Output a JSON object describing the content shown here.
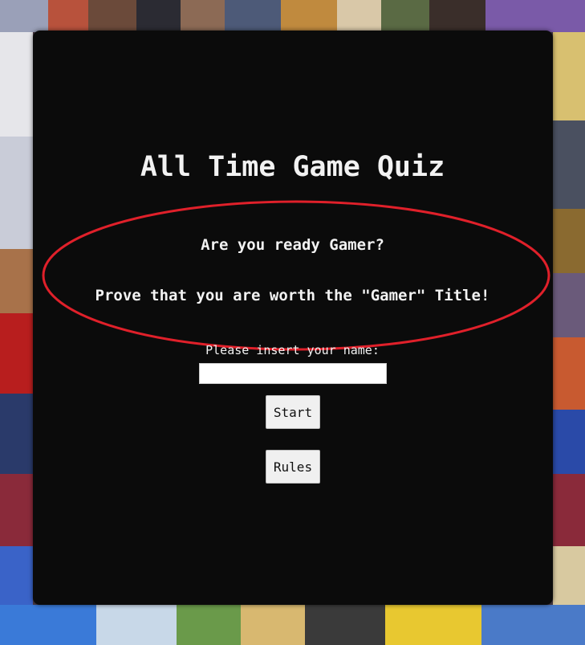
{
  "quiz": {
    "title": "All Time Game Quiz",
    "intro_line1": "Are you ready Gamer?",
    "intro_line2": "Prove that you are worth the \"Gamer\" Title!",
    "name_label": "Please insert your name:",
    "name_value": "",
    "start_label": "Start",
    "rules_label": "Rules"
  },
  "colors": {
    "card_background": "#0b0b0b",
    "text": "#f2f2f2",
    "highlight_ellipse": "#e0202a",
    "button_background": "#f0f0f0"
  }
}
